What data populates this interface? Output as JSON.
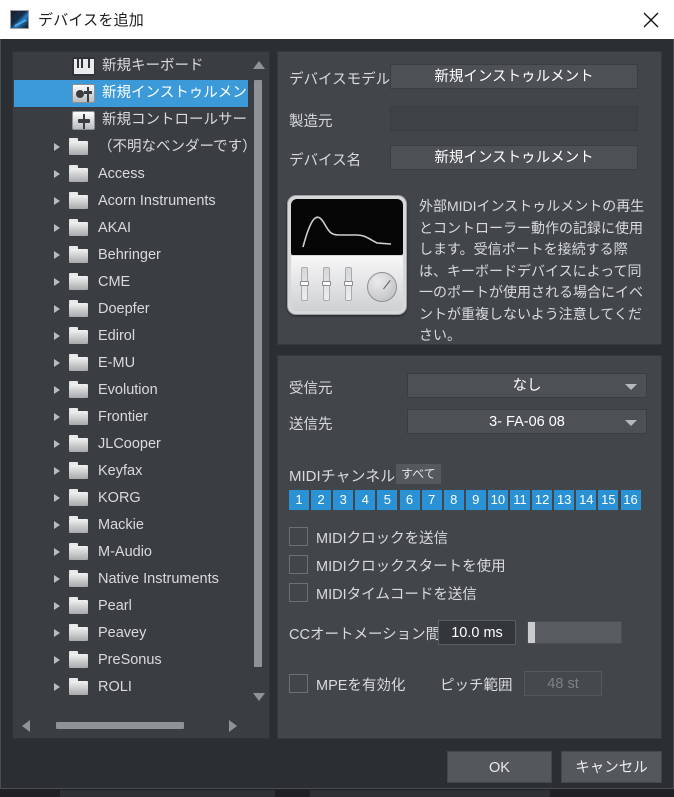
{
  "window": {
    "title": "デバイスを追加",
    "app_icon": "app-logo-icon",
    "close_label": "×"
  },
  "tree": {
    "top_items": [
      {
        "label": "新規キーボード",
        "icon": "keyboard-icon",
        "selected": false
      },
      {
        "label": "新規インストゥルメント",
        "icon": "instrument-icon",
        "selected": true
      },
      {
        "label": "新規コントロールサーフェス",
        "icon": "control-surface-icon",
        "selected": false
      }
    ],
    "vendors": [
      "（不明なベンダーです）",
      "Access",
      "Acorn Instruments",
      "AKAI",
      "Behringer",
      "CME",
      "Doepfer",
      "Edirol",
      "E-MU",
      "Evolution",
      "Frontier",
      "JLCooper",
      "Keyfax",
      "KORG",
      "Mackie",
      "M-Audio",
      "Native Instruments",
      "Pearl",
      "Peavey",
      "PreSonus",
      "ROLI"
    ]
  },
  "details": {
    "device_model_label": "デバイスモデル",
    "device_model_value": "新規インストゥルメント",
    "manufacturer_label": "製造元",
    "manufacturer_value": "",
    "device_name_label": "デバイス名",
    "device_name_value": "新規インストゥルメント",
    "description": "外部MIDIインストゥルメントの再生とコントローラー動作の記録に使用します。受信ポートを接続する際は、キーボードデバイスによって同一のポートが使用される場合にイベントが重複しないよう注意してください。",
    "device_image": "midi-instrument-thumbnail"
  },
  "midi": {
    "receive_from_label": "受信元",
    "receive_from_value": "なし",
    "send_to_label": "送信先",
    "send_to_value": "3- FA-06 08",
    "channels_label": "MIDIチャンネル",
    "all_button": "すべて",
    "channels": [
      "1",
      "2",
      "3",
      "4",
      "5",
      "6",
      "7",
      "8",
      "9",
      "10",
      "11",
      "12",
      "13",
      "14",
      "15",
      "16"
    ],
    "checkboxes": [
      {
        "label": "MIDIクロックを送信",
        "checked": false
      },
      {
        "label": "MIDIクロックスタートを使用",
        "checked": false
      },
      {
        "label": "MIDIタイムコードを送信",
        "checked": false
      }
    ],
    "cc_label": "CCオートメーション間隔",
    "cc_value": "10.0 ms",
    "mpe_label": "MPEを有効化",
    "mpe_checked": false,
    "pitch_range_label": "ピッチ範囲",
    "pitch_range_value": "48 st"
  },
  "footer": {
    "ok": "OK",
    "cancel": "キャンセル"
  },
  "colors": {
    "accent": "#2a92d4",
    "selection": "#3c9ad8",
    "panel": "#42464b",
    "background": "#2b2e33"
  }
}
